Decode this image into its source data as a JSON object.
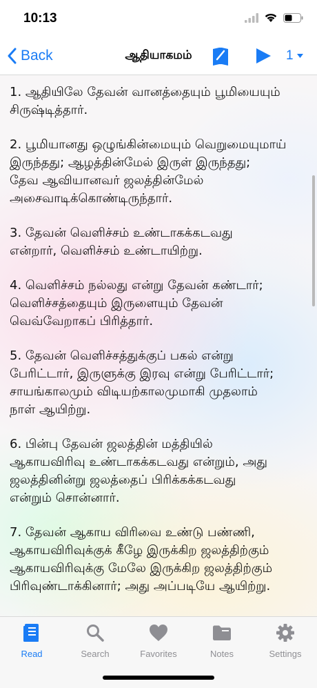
{
  "status": {
    "time": "10:13"
  },
  "nav": {
    "back_label": "Back",
    "title": "ஆதியாகமம்",
    "chapter": "1"
  },
  "verses": [
    "1. ஆதியிலே தேவன் வானத்தையும் பூமியையும்\nசிருஷ்டித்தார்.",
    "2. பூமியானது ஒழுங்கின்மையும் வெறுமையுமாய்\nஇருந்தது; ஆழத்தின்மேல் இருள் இருந்தது;\nதேவ ஆவியானவர் ஜலத்தின்மேல்\nஅசைவாடிக்கொண்டிருந்தார்.",
    "3. தேவன் வெளிச்சம் உண்டாகக்கடவது\nஎன்றார், வெளிச்சம் உண்டாயிற்று.",
    "4. வெளிச்சம் நல்லது என்று தேவன் கண்டார்;\nவெளிச்சத்தையும் இருளையும் தேவன்\nவெவ்வேறாகப் பிரித்தார்.",
    "5. தேவன் வெளிச்சத்துக்குப் பகல் என்று\nபேரிட்டார், இருளுக்கு இரவு என்று பேரிட்டார்;\nசாயங்காலமும் விடியற்காலமுமாகி முதலாம்\nநாள் ஆயிற்று.",
    "6. பின்பு தேவன் ஜலத்தின் மத்தியில்\nஆகாயவிரிவு உண்டாகக்கடவது என்றும், அது\nஜலத்தினின்று ஜலத்தைப் பிரிக்கக்கடவது\nஎன்றும் சொன்னார்.",
    "7. தேவன் ஆகாய விரிவை உண்டு பண்ணி,\nஆகாயவிரிவுக்குக் கீழே இருக்கிற ஜலத்திற்கும்\nஆகாயவிரிவுக்கு மேலே இருக்கிற ஜலத்திற்கும்\nபிரிவுண்டாக்கினார்; அது அப்படியே ஆயிற்று."
  ],
  "tabs": [
    {
      "label": "Read",
      "icon": "book-icon",
      "active": true
    },
    {
      "label": "Search",
      "icon": "magnifier-icon",
      "active": false
    },
    {
      "label": "Favorites",
      "icon": "heart-icon",
      "active": false
    },
    {
      "label": "Notes",
      "icon": "folder-icon",
      "active": false
    },
    {
      "label": "Settings",
      "icon": "gear-icon",
      "active": false
    }
  ],
  "colors": {
    "accent": "#1a7cf5",
    "inactive": "#8e8e93"
  }
}
